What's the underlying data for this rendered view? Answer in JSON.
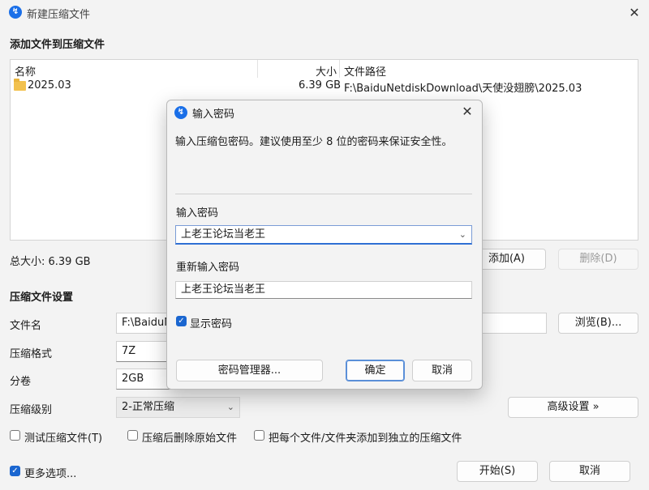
{
  "window": {
    "title": "新建压缩文件",
    "close_glyph": "✕"
  },
  "add_files": {
    "heading": "添加文件到压缩文件",
    "columns": [
      "名称",
      "大小",
      "文件路径"
    ],
    "rows": [
      {
        "name": "2025.03",
        "size": "6.39 GB",
        "path": "F:\\BaiduNetdiskDownload\\天使没翅膀\\2025.03"
      }
    ],
    "total_label": "总大小: 6.39 GB",
    "add_button": "添加(A)",
    "delete_button": "删除(D)"
  },
  "settings": {
    "heading": "压缩文件设置",
    "filename_label": "文件名",
    "filename_value": "F:\\BaiduN",
    "browse_button": "浏览(B)...",
    "format_label": "压缩格式",
    "format_value": "7Z",
    "split_label": "分卷",
    "split_value": "2GB",
    "level_label": "压缩级别",
    "level_value": "2-正常压缩",
    "advanced_button": "高级设置 »",
    "test_label": "测试压缩文件(T)",
    "delete_after_label": "压缩后删除原始文件",
    "each_separate_label": "把每个文件/文件夹添加到独立的压缩文件"
  },
  "footer": {
    "more_options_label": "更多选项...",
    "start_button": "开始(S)",
    "cancel_button": "取消"
  },
  "password_dialog": {
    "title": "输入密码",
    "description": "输入压缩包密码。建议使用至少 8 位的密码来保证安全性。",
    "enter_label": "输入密码",
    "enter_value": "上老王论坛当老王",
    "reenter_label": "重新输入密码",
    "reenter_value": "上老王论坛当老王",
    "show_password_label": "显示密码",
    "manager_button": "密码管理器...",
    "ok_button": "确定",
    "cancel_button": "取消"
  }
}
